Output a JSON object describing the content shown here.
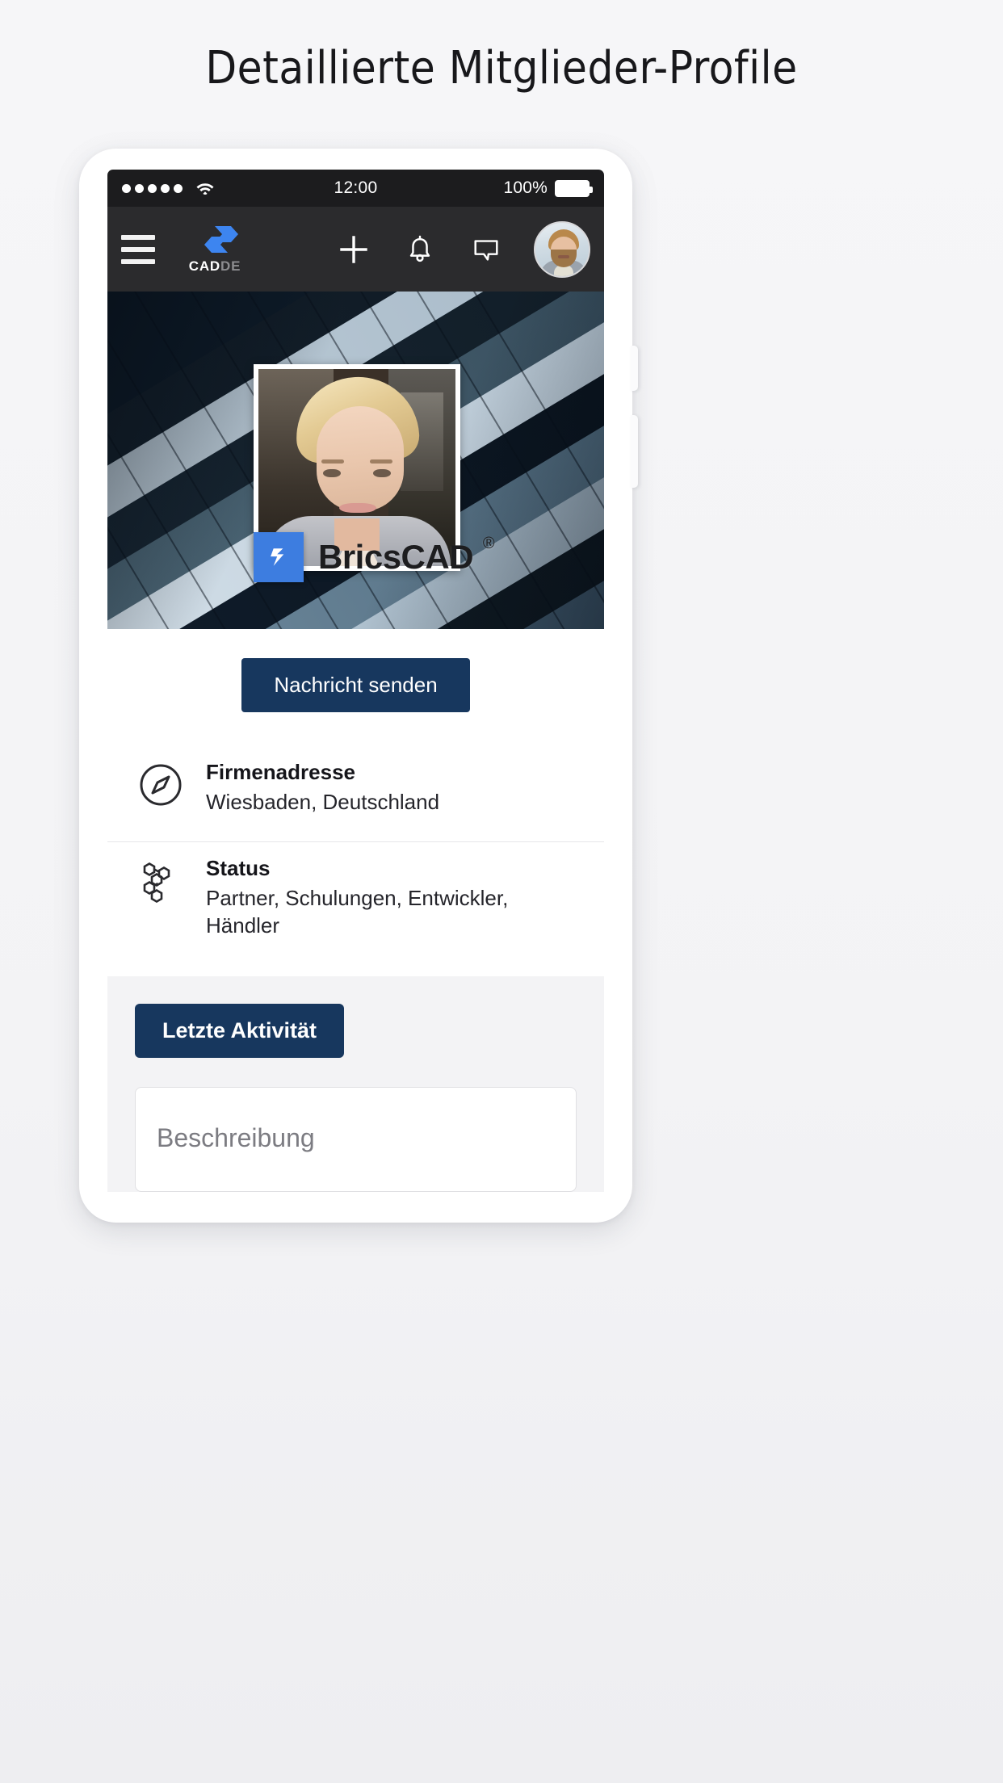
{
  "headline": "Detaillierte Mitglieder-Profile",
  "colors": {
    "accent_navy": "#17375e",
    "brand_blue": "#3d7de0",
    "page_bg": "#f4f4f6",
    "navbar_bg": "#2b2b2d",
    "statusbar_bg": "#1c1c1e"
  },
  "statusbar": {
    "signal_icon": "signal-dots-icon",
    "wifi_icon": "wifi-icon",
    "time": "12:00",
    "battery_percent": "100%",
    "battery_icon": "battery-full-icon"
  },
  "navbar": {
    "menu_icon": "hamburger-menu-icon",
    "logo": {
      "mark_icon": "cad-arrows-logo-icon",
      "text_primary": "CAD",
      "text_secondary": "DE"
    },
    "actions": [
      {
        "name": "add-button",
        "icon": "plus-icon"
      },
      {
        "name": "notifications-button",
        "icon": "bell-icon"
      },
      {
        "name": "messages-button",
        "icon": "speech-bubble-icon"
      }
    ],
    "avatar_icon": "user-avatar"
  },
  "cover": {
    "image_alt": "building-facade-photo",
    "profile_photo_alt": "member-portrait-photo",
    "company_logo": {
      "mark_icon": "bricscad-mark-icon",
      "name": "BricsCAD",
      "registered": "®"
    }
  },
  "profile": {
    "message_button": "Nachricht senden",
    "info": [
      {
        "icon": "compass-icon",
        "title": "Firmenadresse",
        "value": "Wiesbaden, Deutschland"
      },
      {
        "icon": "hexagon-cluster-icon",
        "title": "Status",
        "value": "Partner, Schulungen, Entwickler, Händler"
      }
    ]
  },
  "activity": {
    "tab_label": "Letzte Aktivität",
    "description_placeholder": "Beschreibung"
  }
}
